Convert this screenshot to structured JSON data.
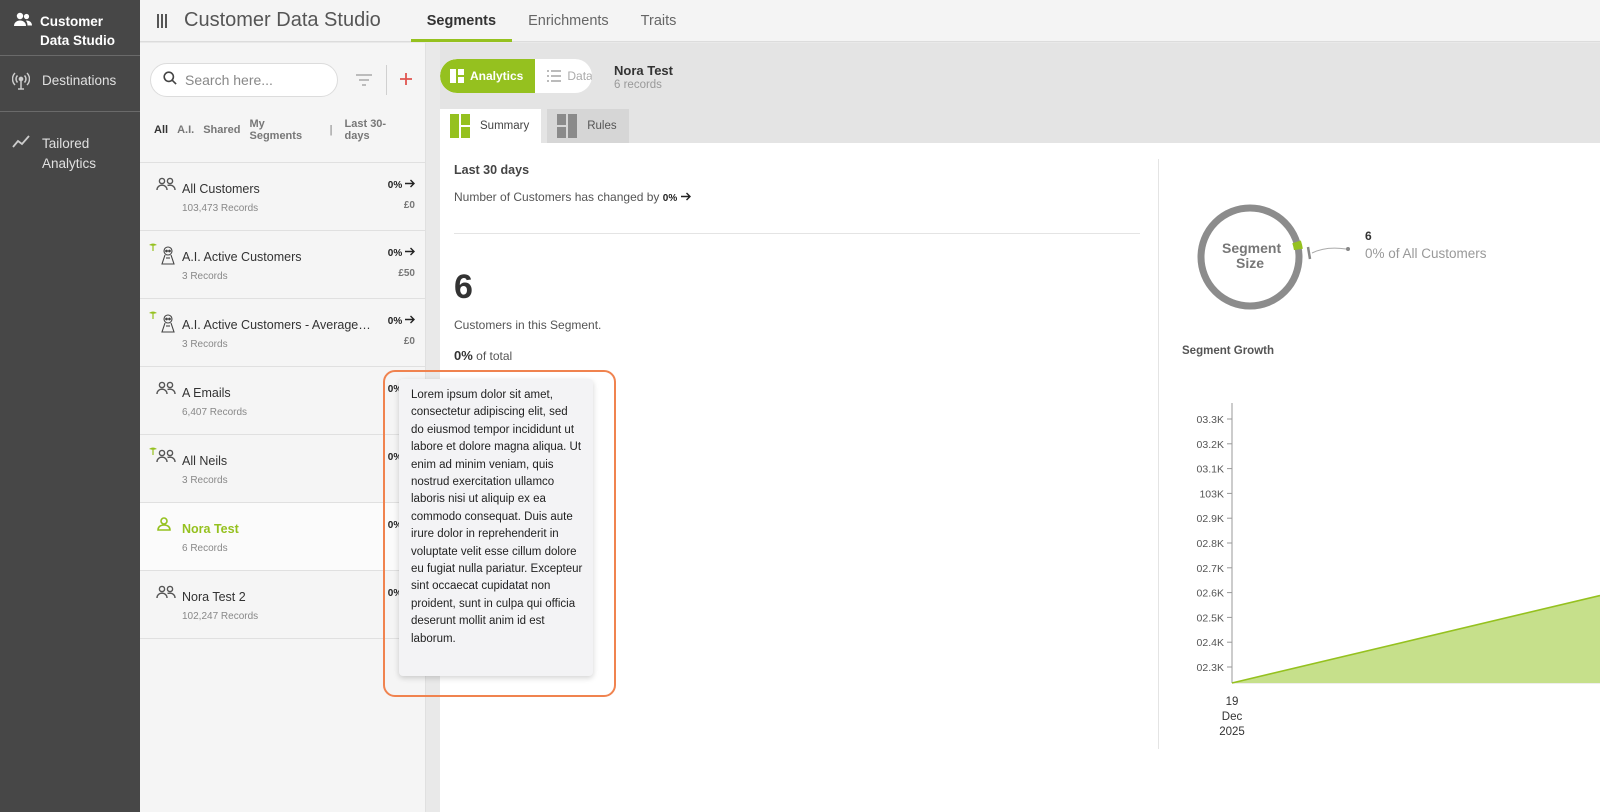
{
  "nav": {
    "brand": "Customer Data Studio",
    "items": [
      {
        "label": "Destinations"
      },
      {
        "label": "Tailored Analytics"
      }
    ]
  },
  "topbar": {
    "title": "Customer Data Studio",
    "tabs": [
      {
        "label": "Segments",
        "active": true
      },
      {
        "label": "Enrichments",
        "active": false
      },
      {
        "label": "Traits",
        "active": false
      }
    ]
  },
  "list": {
    "search_placeholder": "Search here...",
    "filters": [
      "All",
      "A.I.",
      "Shared",
      "My Segments"
    ],
    "period_filter": "Last 30-days",
    "segments": [
      {
        "name": "All Customers",
        "records": "103,473 Records",
        "pct": "0%",
        "value": "£0",
        "icon": "group-icon",
        "ai": false,
        "active": false
      },
      {
        "name": "A.I. Active Customers",
        "records": "3 Records",
        "pct": "0%",
        "value": "£50",
        "icon": "ai-bot-icon",
        "ai": true,
        "active": false
      },
      {
        "name": "A.I. Active Customers - Average V...",
        "records": "3 Records",
        "pct": "0%",
        "value": "£0",
        "icon": "ai-bot-icon",
        "ai": true,
        "active": false
      },
      {
        "name": "A Emails",
        "records": "6,407 Records",
        "pct": "0%",
        "value": "",
        "icon": "group-icon",
        "ai": false,
        "active": false
      },
      {
        "name": "All Neils",
        "records": "3 Records",
        "pct": "0%",
        "value": "",
        "icon": "group-icon",
        "ai": true,
        "active": false
      },
      {
        "name": "Nora Test",
        "records": "6 Records",
        "pct": "0%",
        "value": "",
        "icon": "person-icon",
        "ai": false,
        "active": true
      },
      {
        "name": "Nora Test 2",
        "records": "102,247 Records",
        "pct": "0%",
        "value": "",
        "icon": "group-icon",
        "ai": false,
        "active": false
      }
    ]
  },
  "view": {
    "toggle": {
      "analytics": "Analytics",
      "data": "Data"
    },
    "segment_name": "Nora Test",
    "segment_records": "6 records",
    "subtabs": {
      "summary": "Summary",
      "rules": "Rules"
    }
  },
  "summary": {
    "period": "Last 30 days",
    "change_text": "Number of Customers has changed by",
    "change_value": "0%",
    "count": "6",
    "count_label": "Customers in this Segment.",
    "total_pct": "0%",
    "total_label": "of total"
  },
  "segment_size": {
    "label_line1": "Segment",
    "label_line2": "Size",
    "count": "6",
    "pct_text": "0% of All Customers",
    "fraction": 6e-05
  },
  "growth": {
    "title": "Segment Growth"
  },
  "chart_data": {
    "type": "area",
    "title": "Segment Growth",
    "y_ticks": [
      "02.3K",
      "02.4K",
      "02.5K",
      "02.6K",
      "02.7K",
      "02.8K",
      "02.9K",
      "103K",
      "03.1K",
      "03.2K",
      "03.3K"
    ],
    "x_ticks": [
      "19 Dec 2025"
    ],
    "series": [
      {
        "values": [
          2200,
          2575
        ]
      }
    ],
    "ylim": [
      2200,
      3400
    ],
    "color": "#95c11f"
  },
  "tooltip": {
    "text": "Lorem ipsum dolor sit amet, consectetur adipiscing elit, sed do eiusmod tempor incididunt ut labore et dolore magna aliqua. Ut enim ad minim veniam, quis nostrud exercitation ullamco laboris nisi ut aliquip ex ea commodo consequat. Duis aute irure dolor in reprehenderit in voluptate velit esse cillum dolore eu fugiat nulla pariatur. Excepteur sint occaecat cupidatat non proident, sunt in culpa qui officia deserunt mollit anim id est laborum."
  },
  "colors": {
    "accent": "#95c11f",
    "nav_bg": "#474747",
    "danger": "#e0544f",
    "highlight": "#f0834f"
  }
}
